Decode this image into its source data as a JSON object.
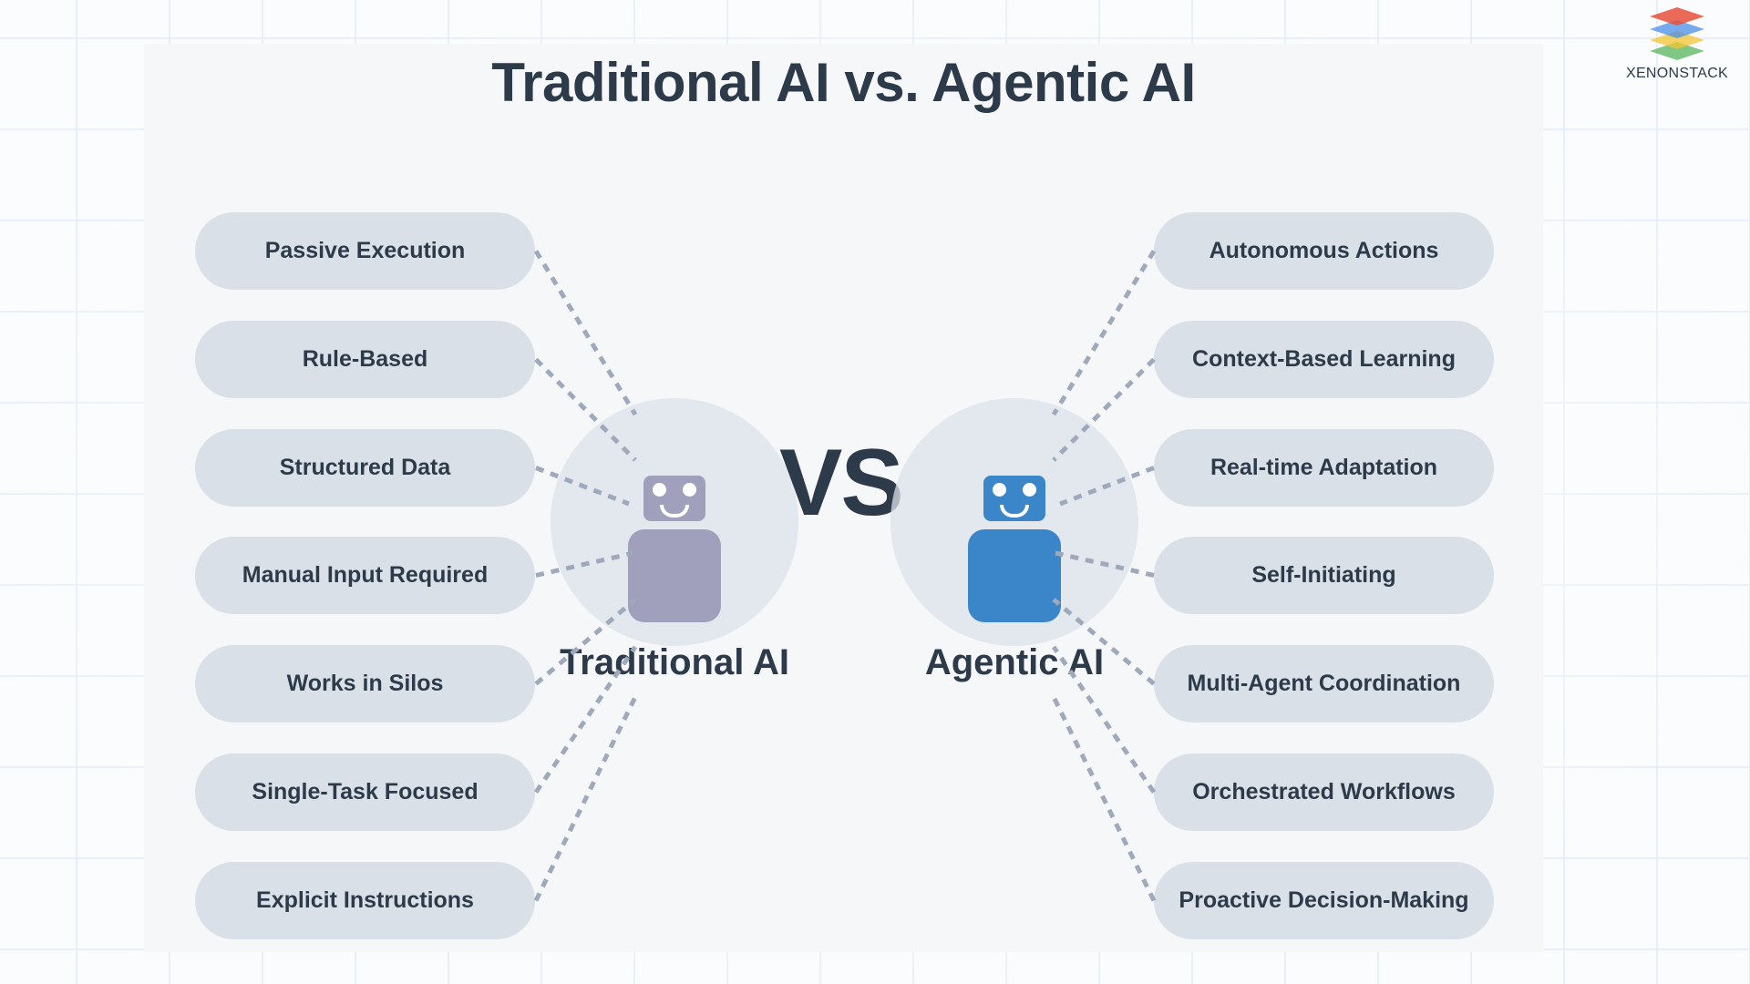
{
  "title": "Traditional AI vs. Agentic AI",
  "logo": {
    "icon": "stacked-layers-logo-icon",
    "text": "XENONSTACK"
  },
  "vs_label": "VS",
  "colors": {
    "text": "#2d3a4a",
    "pill_bg": "#dae0e7",
    "traditional_robot": "#a0a0bc",
    "agentic_robot": "#3b86c8",
    "connector": "#9eaabb"
  },
  "traditional": {
    "label": "Traditional AI",
    "icon": "robot-icon",
    "traits": [
      "Passive Execution",
      "Rule-Based",
      "Structured Data",
      "Manual Input Required",
      "Works in Silos",
      "Single-Task Focused",
      "Explicit Instructions"
    ]
  },
  "agentic": {
    "label": "Agentic AI",
    "icon": "robot-icon",
    "traits": [
      "Autonomous Actions",
      "Context-Based Learning",
      "Real-time Adaptation",
      "Self-Initiating",
      "Multi-Agent Coordination",
      "Orchestrated Workflows",
      "Proactive Decision-Making"
    ]
  }
}
